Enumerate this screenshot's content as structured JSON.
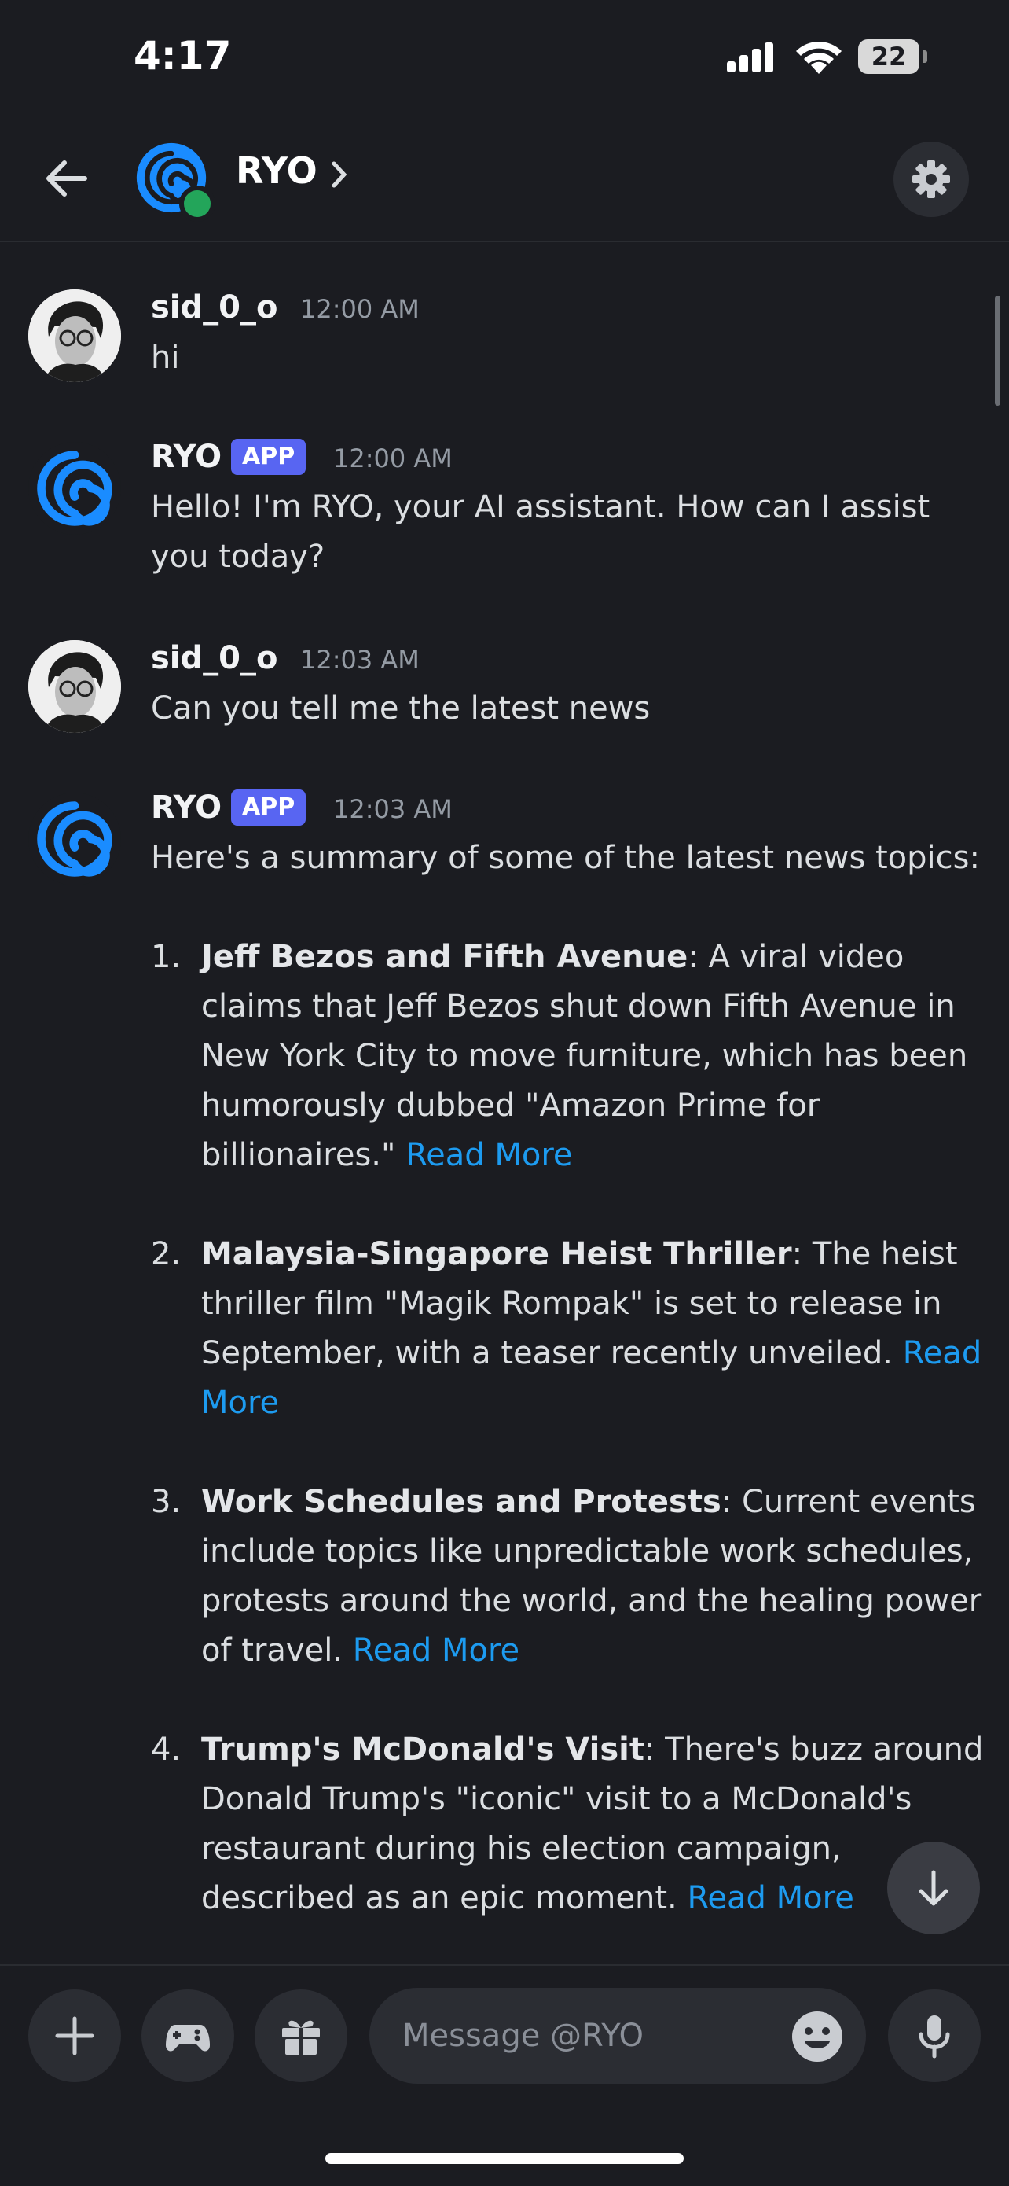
{
  "status_bar": {
    "time": "4:17",
    "battery": "22"
  },
  "header": {
    "title": "RYO"
  },
  "messages": [
    {
      "author": "sid_0_o",
      "time": "12:00 AM",
      "text": "hi"
    },
    {
      "author": "RYO",
      "badge": "APP",
      "time": "12:00 AM",
      "text": "Hello! I'm RYO, your AI assistant. How can I assist you today?"
    },
    {
      "author": "sid_0_o",
      "time": "12:03 AM",
      "text": "Can you tell me the latest news"
    },
    {
      "author": "RYO",
      "badge": "APP",
      "time": "12:03 AM",
      "text": "Here's a summary of some of the latest news topics:"
    }
  ],
  "news": [
    {
      "num": "1.",
      "title": "Jeff Bezos and Fifth Avenue",
      "text": ": A viral video claims that Jeff Bezos shut down Fifth Avenue in New York City to move furniture, which has been humorously dubbed \"Amazon Prime for billionaires.\" ",
      "link": "Read More"
    },
    {
      "num": "2.",
      "title": "Malaysia-Singapore Heist Thriller",
      "text": ": The heist thriller film \"Magik Rompak\" is set to release in September, with a teaser recently unveiled. ",
      "link": "Read More"
    },
    {
      "num": "3.",
      "title": "Work Schedules and Protests",
      "text": ": Current events include topics like unpredictable work schedules, protests around the world, and the healing power of travel. ",
      "link": "Read More"
    },
    {
      "num": "4.",
      "title": "Trump's McDonald's Visit",
      "text": ": There's buzz around Donald Trump's \"iconic\" visit to a McDonald's restaurant during his election campaign, described as an epic moment. ",
      "link": "Read More"
    }
  ],
  "composer": {
    "placeholder": "Message @RYO"
  },
  "icons": {
    "back": "arrow-left-icon",
    "settings": "gear-icon",
    "jump": "arrow-down-icon",
    "add": "plus-icon",
    "activities": "gamepad-icon",
    "gift": "gift-icon",
    "emoji": "smiley-icon",
    "voice": "microphone-icon"
  },
  "colors": {
    "accent": "#5865f2",
    "link": "#1d9bf0",
    "online": "#23a55a",
    "ryo_brand": "#1a8cff"
  }
}
